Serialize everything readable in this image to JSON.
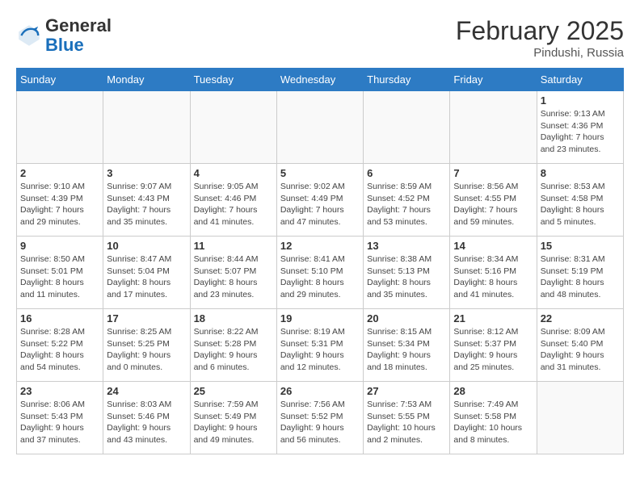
{
  "header": {
    "logo_line1": "General",
    "logo_line2": "Blue",
    "month_title": "February 2025",
    "location": "Pindushi, Russia"
  },
  "weekdays": [
    "Sunday",
    "Monday",
    "Tuesday",
    "Wednesday",
    "Thursday",
    "Friday",
    "Saturday"
  ],
  "weeks": [
    [
      {
        "day": "",
        "info": ""
      },
      {
        "day": "",
        "info": ""
      },
      {
        "day": "",
        "info": ""
      },
      {
        "day": "",
        "info": ""
      },
      {
        "day": "",
        "info": ""
      },
      {
        "day": "",
        "info": ""
      },
      {
        "day": "1",
        "info": "Sunrise: 9:13 AM\nSunset: 4:36 PM\nDaylight: 7 hours\nand 23 minutes."
      }
    ],
    [
      {
        "day": "2",
        "info": "Sunrise: 9:10 AM\nSunset: 4:39 PM\nDaylight: 7 hours\nand 29 minutes."
      },
      {
        "day": "3",
        "info": "Sunrise: 9:07 AM\nSunset: 4:43 PM\nDaylight: 7 hours\nand 35 minutes."
      },
      {
        "day": "4",
        "info": "Sunrise: 9:05 AM\nSunset: 4:46 PM\nDaylight: 7 hours\nand 41 minutes."
      },
      {
        "day": "5",
        "info": "Sunrise: 9:02 AM\nSunset: 4:49 PM\nDaylight: 7 hours\nand 47 minutes."
      },
      {
        "day": "6",
        "info": "Sunrise: 8:59 AM\nSunset: 4:52 PM\nDaylight: 7 hours\nand 53 minutes."
      },
      {
        "day": "7",
        "info": "Sunrise: 8:56 AM\nSunset: 4:55 PM\nDaylight: 7 hours\nand 59 minutes."
      },
      {
        "day": "8",
        "info": "Sunrise: 8:53 AM\nSunset: 4:58 PM\nDaylight: 8 hours\nand 5 minutes."
      }
    ],
    [
      {
        "day": "9",
        "info": "Sunrise: 8:50 AM\nSunset: 5:01 PM\nDaylight: 8 hours\nand 11 minutes."
      },
      {
        "day": "10",
        "info": "Sunrise: 8:47 AM\nSunset: 5:04 PM\nDaylight: 8 hours\nand 17 minutes."
      },
      {
        "day": "11",
        "info": "Sunrise: 8:44 AM\nSunset: 5:07 PM\nDaylight: 8 hours\nand 23 minutes."
      },
      {
        "day": "12",
        "info": "Sunrise: 8:41 AM\nSunset: 5:10 PM\nDaylight: 8 hours\nand 29 minutes."
      },
      {
        "day": "13",
        "info": "Sunrise: 8:38 AM\nSunset: 5:13 PM\nDaylight: 8 hours\nand 35 minutes."
      },
      {
        "day": "14",
        "info": "Sunrise: 8:34 AM\nSunset: 5:16 PM\nDaylight: 8 hours\nand 41 minutes."
      },
      {
        "day": "15",
        "info": "Sunrise: 8:31 AM\nSunset: 5:19 PM\nDaylight: 8 hours\nand 48 minutes."
      }
    ],
    [
      {
        "day": "16",
        "info": "Sunrise: 8:28 AM\nSunset: 5:22 PM\nDaylight: 8 hours\nand 54 minutes."
      },
      {
        "day": "17",
        "info": "Sunrise: 8:25 AM\nSunset: 5:25 PM\nDaylight: 9 hours\nand 0 minutes."
      },
      {
        "day": "18",
        "info": "Sunrise: 8:22 AM\nSunset: 5:28 PM\nDaylight: 9 hours\nand 6 minutes."
      },
      {
        "day": "19",
        "info": "Sunrise: 8:19 AM\nSunset: 5:31 PM\nDaylight: 9 hours\nand 12 minutes."
      },
      {
        "day": "20",
        "info": "Sunrise: 8:15 AM\nSunset: 5:34 PM\nDaylight: 9 hours\nand 18 minutes."
      },
      {
        "day": "21",
        "info": "Sunrise: 8:12 AM\nSunset: 5:37 PM\nDaylight: 9 hours\nand 25 minutes."
      },
      {
        "day": "22",
        "info": "Sunrise: 8:09 AM\nSunset: 5:40 PM\nDaylight: 9 hours\nand 31 minutes."
      }
    ],
    [
      {
        "day": "23",
        "info": "Sunrise: 8:06 AM\nSunset: 5:43 PM\nDaylight: 9 hours\nand 37 minutes."
      },
      {
        "day": "24",
        "info": "Sunrise: 8:03 AM\nSunset: 5:46 PM\nDaylight: 9 hours\nand 43 minutes."
      },
      {
        "day": "25",
        "info": "Sunrise: 7:59 AM\nSunset: 5:49 PM\nDaylight: 9 hours\nand 49 minutes."
      },
      {
        "day": "26",
        "info": "Sunrise: 7:56 AM\nSunset: 5:52 PM\nDaylight: 9 hours\nand 56 minutes."
      },
      {
        "day": "27",
        "info": "Sunrise: 7:53 AM\nSunset: 5:55 PM\nDaylight: 10 hours\nand 2 minutes."
      },
      {
        "day": "28",
        "info": "Sunrise: 7:49 AM\nSunset: 5:58 PM\nDaylight: 10 hours\nand 8 minutes."
      },
      {
        "day": "",
        "info": ""
      }
    ]
  ]
}
